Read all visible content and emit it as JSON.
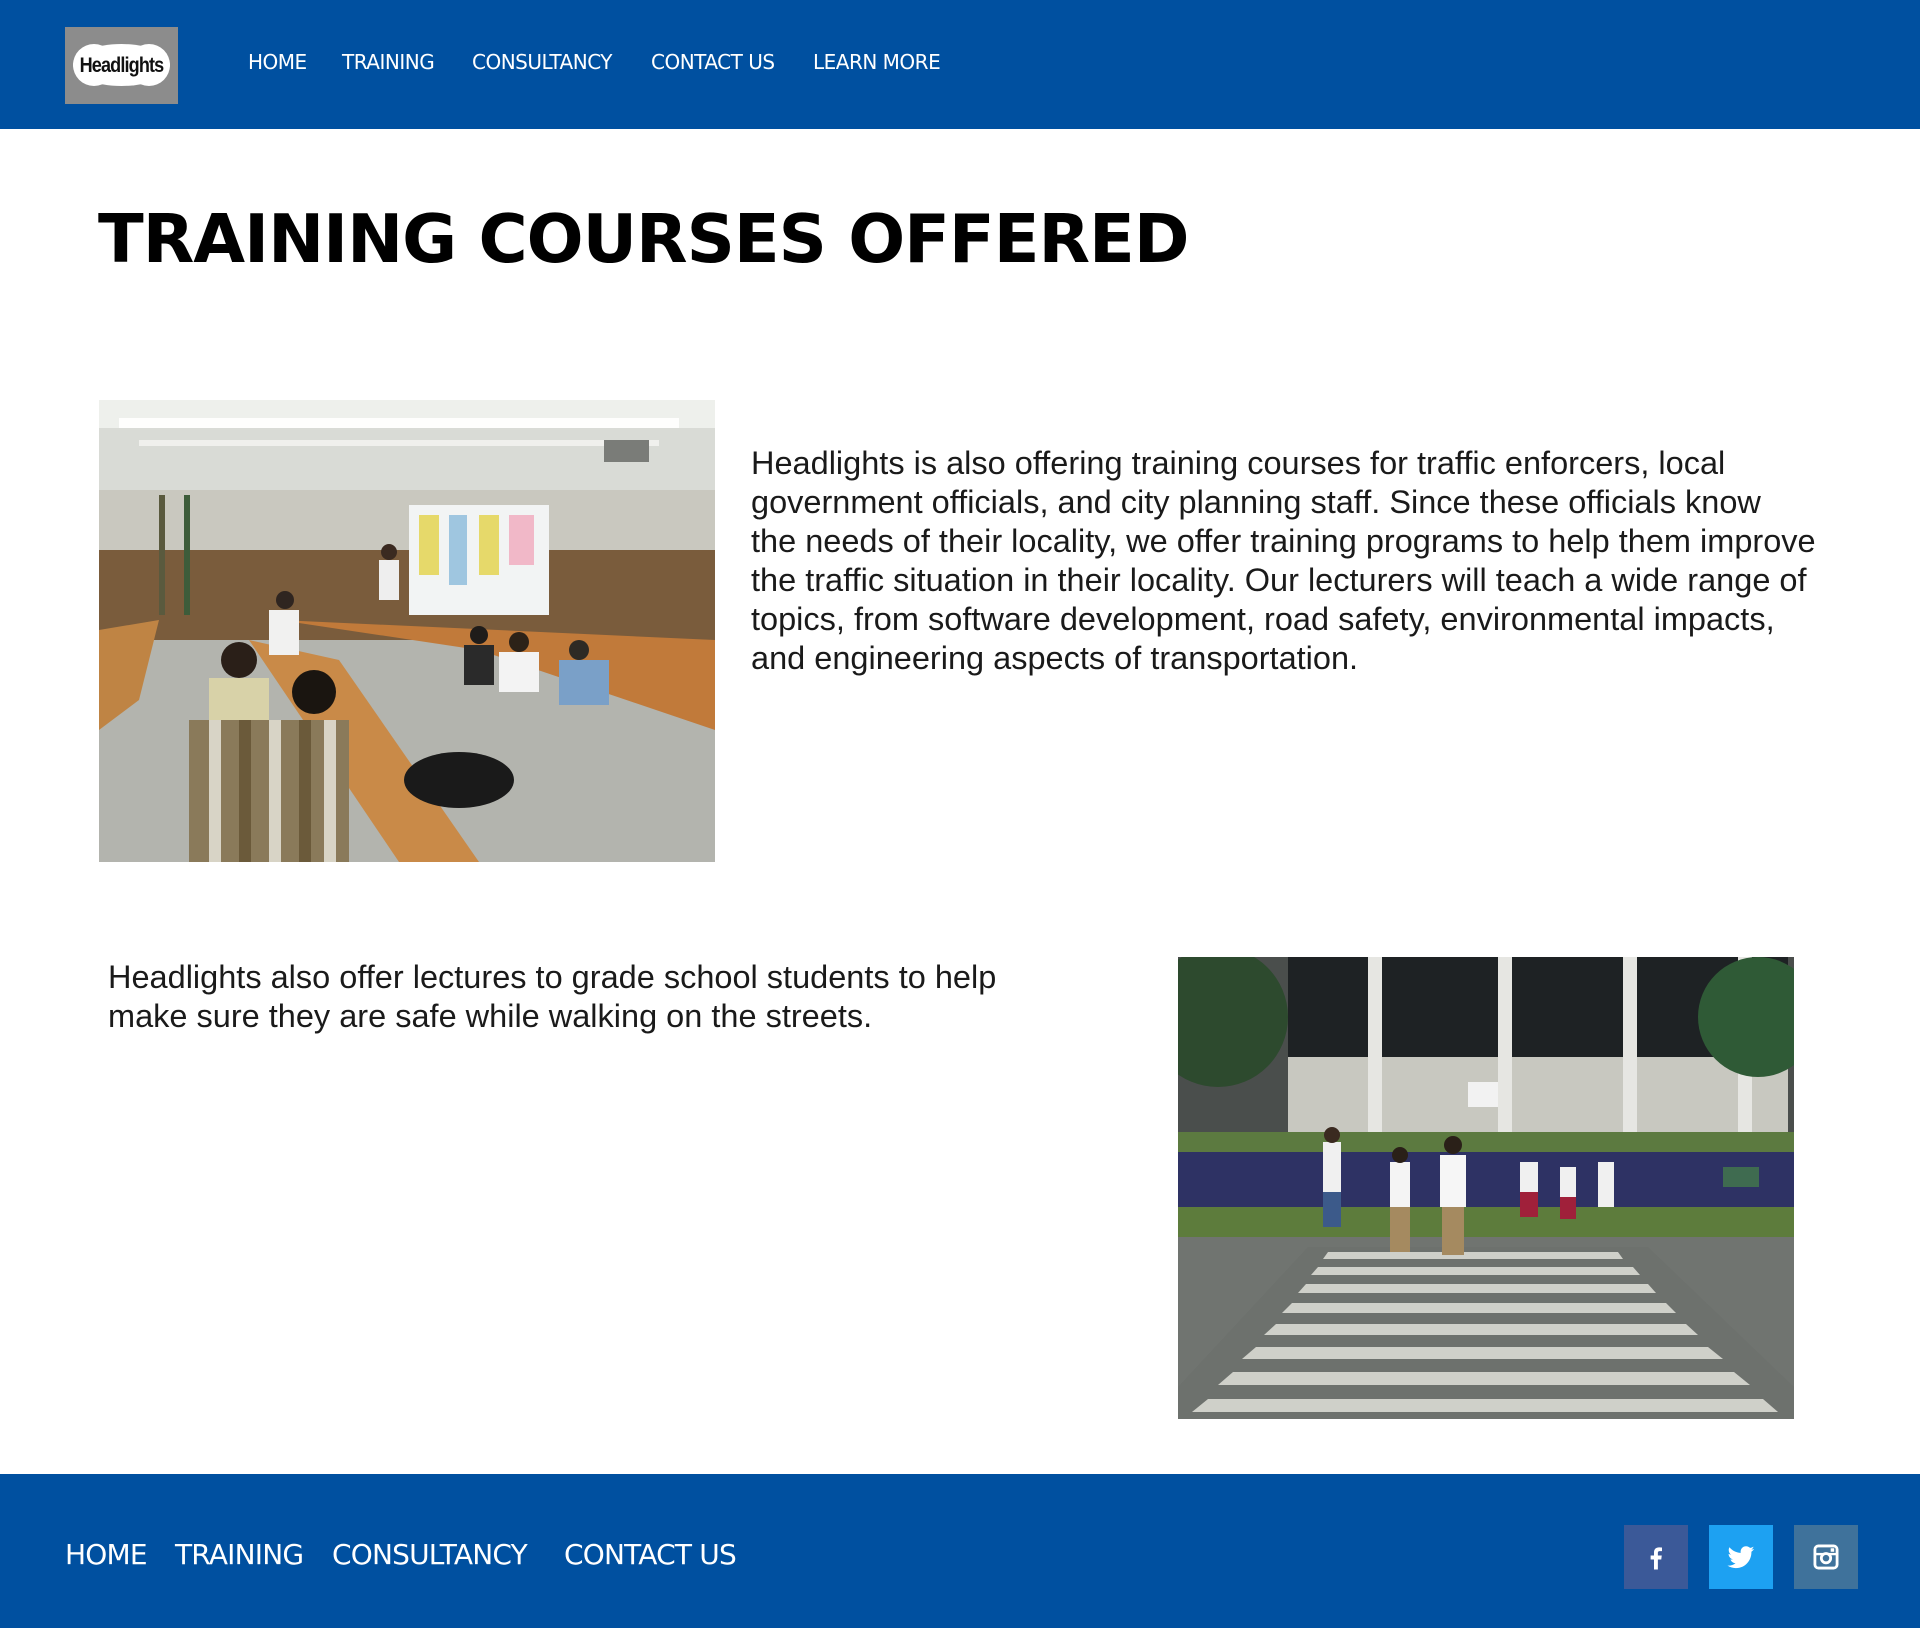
{
  "header": {
    "logo_text": "Headlights",
    "nav": [
      {
        "label": "HOME"
      },
      {
        "label": "TRAINING"
      },
      {
        "label": "CONSULTANCY"
      },
      {
        "label": "CONTACT US"
      },
      {
        "label": "LEARN MORE"
      }
    ]
  },
  "main": {
    "title": "TRAINING COURSES OFFERED",
    "section1": {
      "lines": [
        "Headlights is also offering training courses for traffic enforcers, local",
        "government officials, and city planning staff. Since these officials know",
        "the needs of their locality, we offer training programs to help them improve",
        "the traffic situation in their locality. Our lecturers will teach a wide range of",
        "topics, from software development, road safety, environmental impacts,",
        "and engineering aspects of transportation."
      ]
    },
    "section2": {
      "lines": [
        "Headlights also offer lectures to grade school students to help",
        "make sure they are safe while walking on the streets."
      ]
    }
  },
  "footer": {
    "nav": [
      {
        "label": "HOME"
      },
      {
        "label": "TRAINING"
      },
      {
        "label": "CONSULTANCY"
      },
      {
        "label": "CONTACT US"
      }
    ],
    "social": [
      {
        "icon": "facebook-icon",
        "color": "#3b5998"
      },
      {
        "icon": "twitter-icon",
        "color": "#1da1f2"
      },
      {
        "icon": "instagram-icon",
        "color": "#3f729b"
      }
    ]
  }
}
